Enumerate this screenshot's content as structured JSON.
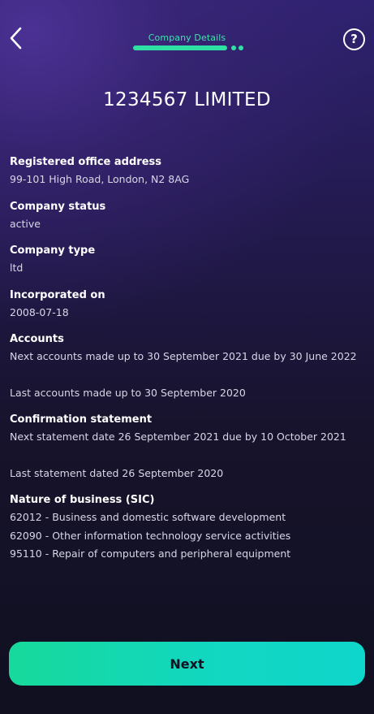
{
  "header": {
    "step_title": "Company Details",
    "back_icon": "chevron-left-icon",
    "help_icon": "question-circle-icon",
    "help_glyph": "?",
    "progress": {
      "filled_steps": 1,
      "remaining_steps": 2
    }
  },
  "company": {
    "name": "1234567 LIMITED"
  },
  "details": {
    "registered_office": {
      "label": "Registered office address",
      "value": "99-101 High Road, London, N2 8AG"
    },
    "status": {
      "label": "Company status",
      "value": "active"
    },
    "type": {
      "label": "Company type",
      "value": "ltd"
    },
    "incorporated": {
      "label": "Incorporated on",
      "value": "2008-07-18"
    },
    "accounts": {
      "label": "Accounts",
      "next": "Next accounts made up to 30 September 2021 due by 30 June 2022",
      "last": "Last accounts made up to 30 September 2020"
    },
    "confirmation": {
      "label": "Confirmation statement",
      "next": "Next statement date 26 September 2021 due by 10 October 2021",
      "last": "Last statement dated 26 September 2020"
    },
    "sic": {
      "label": "Nature of business (SIC)",
      "items": [
        "62012 - Business and domestic software development",
        "62090 - Other information technology service activities",
        "95110 - Repair of computers and peripheral equipment"
      ]
    }
  },
  "footer": {
    "next_label": "Next"
  },
  "colors": {
    "accent": "#2ee0a4",
    "button_start": "#17d99b",
    "button_end": "#0fd6cc",
    "background_top": "#2f2270",
    "background_bottom": "#101020"
  }
}
